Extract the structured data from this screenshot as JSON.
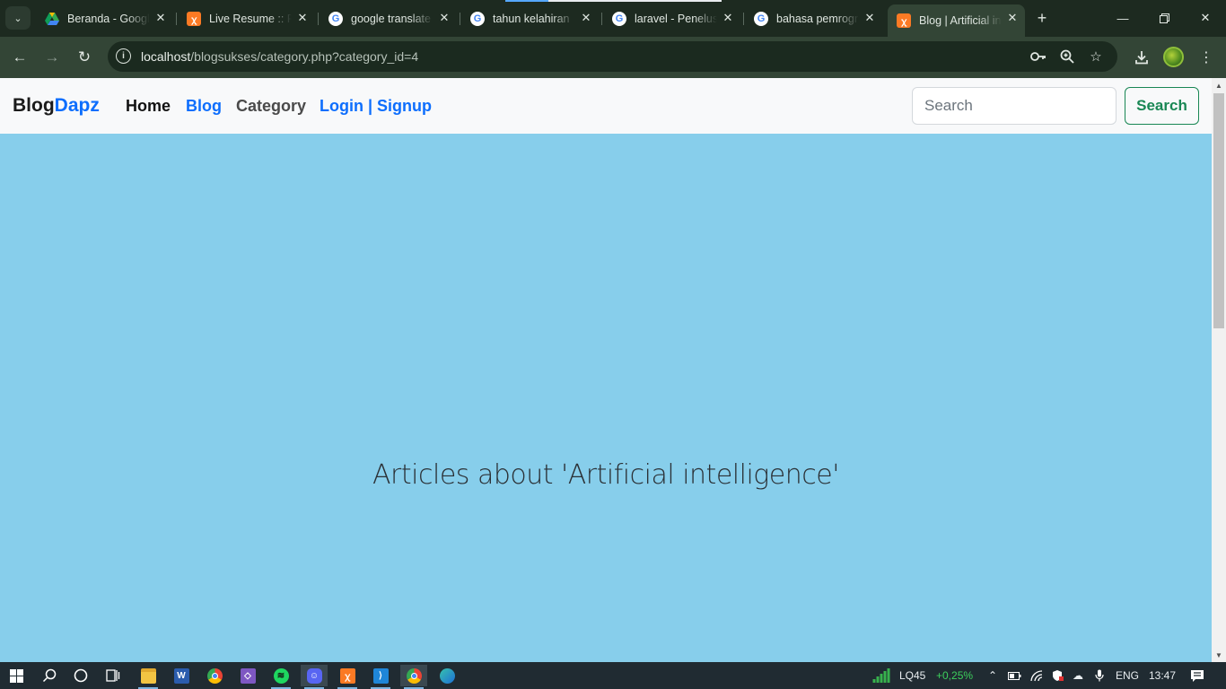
{
  "browser": {
    "tabs": [
      {
        "title": "Beranda - Google Drive",
        "icon": "google-drive-icon"
      },
      {
        "title": "Live Resume :: Portfolio",
        "icon": "xampp-icon"
      },
      {
        "title": "google translate",
        "icon": "google-icon"
      },
      {
        "title": "tahun kelahiran",
        "icon": "google-icon"
      },
      {
        "title": "laravel - Penelusuran",
        "icon": "google-icon"
      },
      {
        "title": "bahasa pemrograman",
        "icon": "google-icon"
      },
      {
        "title": "Blog | Artificial intelligence",
        "icon": "xampp-icon",
        "active": true
      }
    ],
    "url": {
      "host": "localhost",
      "path": "/blogsukses/category.php?category_id=4"
    }
  },
  "site": {
    "brand_part1": "Blog",
    "brand_part2": "Dapz",
    "nav": {
      "home": "Home",
      "blog": "Blog",
      "category": "Category",
      "auth": "Login | Signup"
    },
    "search": {
      "placeholder": "Search",
      "button": "Search"
    },
    "heading": "Articles about 'Artificial intelligence'",
    "colors": {
      "page_background": "#87ceeb",
      "brand_accent": "#0d6efd",
      "search_button": "#198754"
    }
  },
  "taskbar": {
    "stock_symbol": "LQ45",
    "stock_change": "+0,25%",
    "language": "ENG",
    "time": "13:47"
  }
}
